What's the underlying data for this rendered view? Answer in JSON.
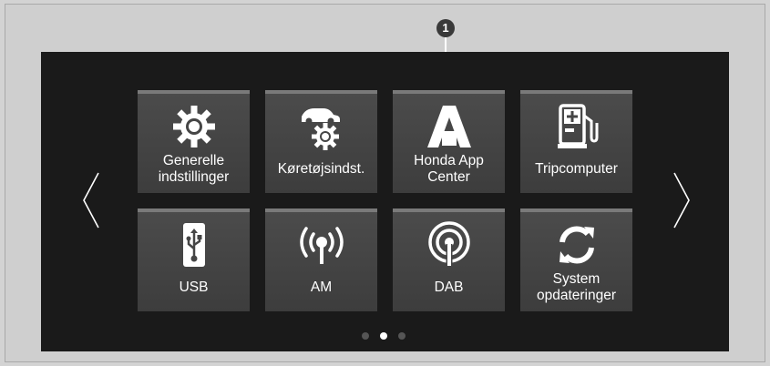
{
  "callout": {
    "number": "1"
  },
  "tiles": [
    {
      "label": "Generelle\nindstillinger",
      "icon": "gear-icon"
    },
    {
      "label": "Køretøjsindst.",
      "icon": "car-settings-icon"
    },
    {
      "label": "Honda App\nCenter",
      "icon": "honda-app-center-icon"
    },
    {
      "label": "Tripcomputer",
      "icon": "fuel-pump-icon"
    },
    {
      "label": "USB",
      "icon": "usb-icon"
    },
    {
      "label": "AM",
      "icon": "am-radio-icon"
    },
    {
      "label": "DAB",
      "icon": "dab-radio-icon"
    },
    {
      "label": "System\nopdateringer",
      "icon": "refresh-icon"
    }
  ],
  "pagination": {
    "pages": 3,
    "current": 2
  },
  "colors": {
    "screen_bg": "#1a1a1a",
    "tile_bg": "#444444",
    "tile_border": "#7a7a7a",
    "text": "#ffffff"
  }
}
